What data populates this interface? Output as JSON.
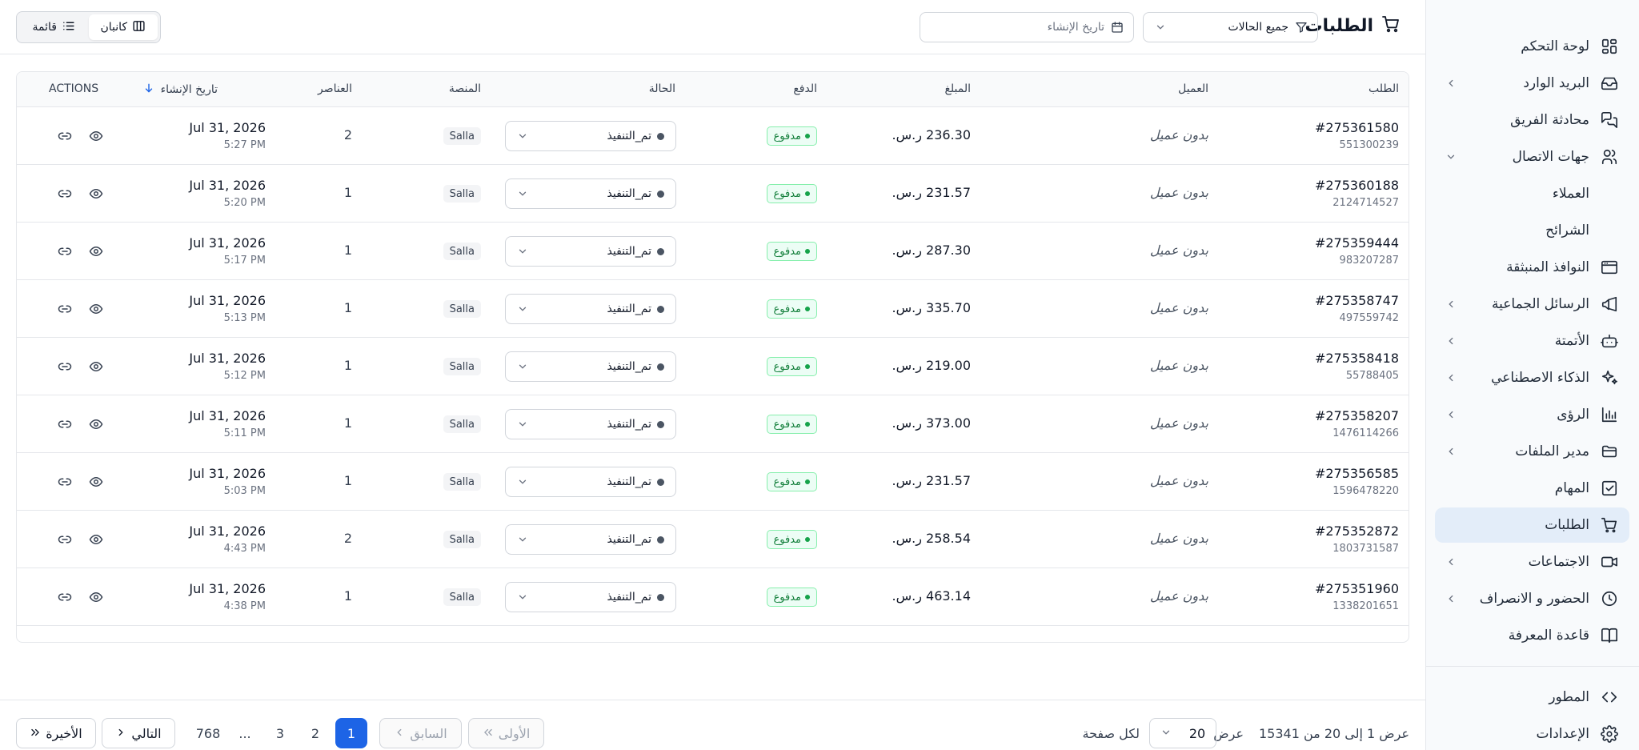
{
  "header": {
    "title": "الطلبات",
    "status_filter": "جميع الحالات",
    "date_placeholder": "تاريخ الإنشاء",
    "view_kanban": "كانبان",
    "view_list": "قائمة"
  },
  "sidebar": {
    "items": [
      {
        "label": "لوحة التحكم",
        "icon": "dashboard-icon",
        "chevron": false
      },
      {
        "label": "البريد الوارد",
        "icon": "inbox-icon",
        "chevron": true
      },
      {
        "label": "محادثة الفريق",
        "icon": "chat-icon",
        "chevron": false
      },
      {
        "label": "جهات الاتصال",
        "icon": "users-icon",
        "chevron": true,
        "expanded": true
      },
      {
        "label": "العملاء",
        "sub": true
      },
      {
        "label": "الشرائح",
        "sub": true
      },
      {
        "label": "النوافذ المنبثقة",
        "icon": "popup-icon",
        "chevron": false
      },
      {
        "label": "الرسائل الجماعية",
        "icon": "megaphone-icon",
        "chevron": true
      },
      {
        "label": "الأتمتة",
        "icon": "bot-icon",
        "chevron": true
      },
      {
        "label": "الذكاء الاصطناعي",
        "icon": "sparkles-icon",
        "chevron": true
      },
      {
        "label": "الرؤى",
        "icon": "chart-icon",
        "chevron": true
      },
      {
        "label": "مدير الملفات",
        "icon": "folder-icon",
        "chevron": true
      },
      {
        "label": "المهام",
        "icon": "checkbox-icon",
        "chevron": false
      },
      {
        "label": "الطلبات",
        "icon": "cart-icon",
        "chevron": false,
        "active": true
      },
      {
        "label": "الاجتماعات",
        "icon": "video-icon",
        "chevron": true
      },
      {
        "label": "الحضور و الانصراف",
        "icon": "clock-icon",
        "chevron": true
      },
      {
        "label": "قاعدة المعرفة",
        "icon": "book-icon",
        "chevron": false
      }
    ],
    "bottom": [
      {
        "label": "المطور",
        "icon": "code-icon"
      },
      {
        "label": "الإعدادات",
        "icon": "gear-icon"
      }
    ]
  },
  "table": {
    "columns": {
      "order": "الطلب",
      "customer": "العميل",
      "amount": "المبلغ",
      "payment": "الدفع",
      "status": "الحالة",
      "platform": "المنصة",
      "items": "العناصر",
      "created": "تاريخ الإنشاء",
      "actions": "ACTIONS"
    },
    "rows": [
      {
        "id": "#275361580",
        "sub": "551300239",
        "customer": "بدون عميل",
        "amount": "236.30 ر.س.",
        "payment": "مدفوع",
        "status": "تم_التنفيذ",
        "platform": "Salla",
        "items": "2",
        "date": "Jul 31, 2026",
        "time": "5:27 PM"
      },
      {
        "id": "#275360188",
        "sub": "2124714527",
        "customer": "بدون عميل",
        "amount": "231.57 ر.س.",
        "payment": "مدفوع",
        "status": "تم_التنفيذ",
        "platform": "Salla",
        "items": "1",
        "date": "Jul 31, 2026",
        "time": "5:20 PM"
      },
      {
        "id": "#275359444",
        "sub": "983207287",
        "customer": "بدون عميل",
        "amount": "287.30 ر.س.",
        "payment": "مدفوع",
        "status": "تم_التنفيذ",
        "platform": "Salla",
        "items": "1",
        "date": "Jul 31, 2026",
        "time": "5:17 PM"
      },
      {
        "id": "#275358747",
        "sub": "497559742",
        "customer": "بدون عميل",
        "amount": "335.70 ر.س.",
        "payment": "مدفوع",
        "status": "تم_التنفيذ",
        "platform": "Salla",
        "items": "1",
        "date": "Jul 31, 2026",
        "time": "5:13 PM"
      },
      {
        "id": "#275358418",
        "sub": "55788405",
        "customer": "بدون عميل",
        "amount": "219.00 ر.س.",
        "payment": "مدفوع",
        "status": "تم_التنفيذ",
        "platform": "Salla",
        "items": "1",
        "date": "Jul 31, 2026",
        "time": "5:12 PM"
      },
      {
        "id": "#275358207",
        "sub": "1476114266",
        "customer": "بدون عميل",
        "amount": "373.00 ر.س.",
        "payment": "مدفوع",
        "status": "تم_التنفيذ",
        "platform": "Salla",
        "items": "1",
        "date": "Jul 31, 2026",
        "time": "5:11 PM"
      },
      {
        "id": "#275356585",
        "sub": "1596478220",
        "customer": "بدون عميل",
        "amount": "231.57 ر.س.",
        "payment": "مدفوع",
        "status": "تم_التنفيذ",
        "platform": "Salla",
        "items": "1",
        "date": "Jul 31, 2026",
        "time": "5:03 PM"
      },
      {
        "id": "#275352872",
        "sub": "1803731587",
        "customer": "بدون عميل",
        "amount": "258.54 ر.س.",
        "payment": "مدفوع",
        "status": "تم_التنفيذ",
        "platform": "Salla",
        "items": "2",
        "date": "Jul 31, 2026",
        "time": "4:43 PM"
      },
      {
        "id": "#275351960",
        "sub": "1338201651",
        "customer": "بدون عميل",
        "amount": "463.14 ر.س.",
        "payment": "مدفوع",
        "status": "تم_التنفيذ",
        "platform": "Salla",
        "items": "1",
        "date": "Jul 31, 2026",
        "time": "4:38 PM"
      }
    ]
  },
  "pagination": {
    "summary": "عرض 1 إلى 20 من 15341",
    "show_label": "عرض",
    "per_page": "20",
    "per_page_suffix": "لكل صفحة",
    "first": "الأولى",
    "prev": "السابق",
    "next": "التالي",
    "last": "الأخيرة",
    "pages": [
      "1",
      "2",
      "3",
      "...",
      "768"
    ],
    "current": "1"
  },
  "colors": {
    "accent": "#1d64e6",
    "active_nav": "#e3edf9",
    "paid_green": "#15803d"
  }
}
